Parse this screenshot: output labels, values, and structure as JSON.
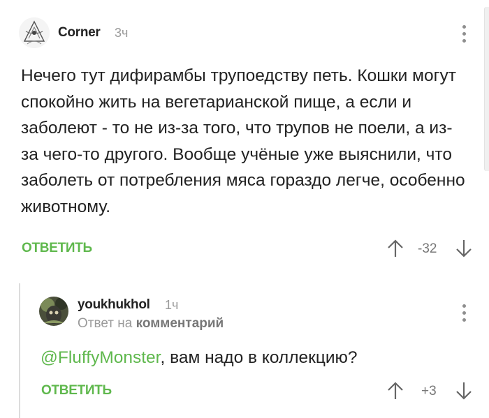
{
  "comment1": {
    "author": "Corner",
    "time": "3ч",
    "text": "Нечего тут дифирамбы трупоедству петь. Кошки могут спокойно жить на вегетарианской пище, а если и заболеют - то не из-за того, что трупов не поели, а из-за чего-то другого. Вообще учёные уже выяснили, что заболеть от потребления мяса гораздо легче, особенно животному.",
    "reply_label": "ОТВЕТИТЬ",
    "rating": "-32"
  },
  "comment2": {
    "author": "youkhukhol",
    "time": "1ч",
    "reply_to_prefix": "Ответ на",
    "reply_to_target": "комментарий",
    "mention": "@FluffyMonster",
    "text": ", вам надо в коллекцию?",
    "reply_label": "ОТВЕТИТЬ",
    "rating": "+3"
  },
  "icons": {
    "menu": "kebab-menu-icon",
    "upvote": "arrow-up-icon",
    "downvote": "arrow-down-icon"
  },
  "colors": {
    "accent": "#5fb84d",
    "muted": "#9a9a9a"
  }
}
